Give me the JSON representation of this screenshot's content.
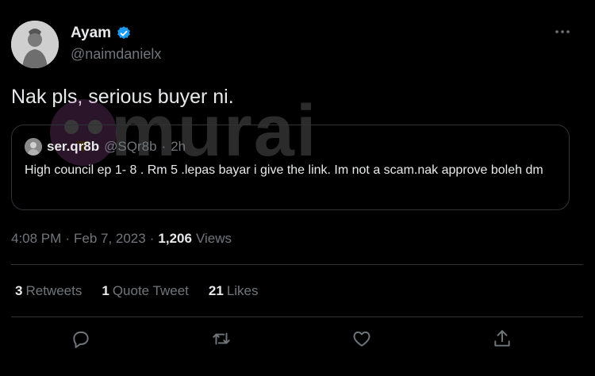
{
  "author": {
    "display_name": "Ayam",
    "handle": "@naimdanielx",
    "verified_icon": "verified-badge-icon"
  },
  "tweet": {
    "text": "Nak pls, serious buyer ni."
  },
  "quote": {
    "name": "ser.qr8b",
    "handle": "@SQr8b",
    "separator": "·",
    "time": "2h",
    "text": "High council ep 1- 8 . Rm 5 .lepas bayar i give the link. Im not a scam.nak approve boleh dm"
  },
  "meta": {
    "time": "4:08 PM",
    "separator1": "·",
    "date": "Feb 7, 2023",
    "separator2": "·",
    "views_count": "1,206",
    "views_label": "Views"
  },
  "stats": {
    "retweets": {
      "count": "3",
      "label": "Retweets"
    },
    "quotes": {
      "count": "1",
      "label": "Quote Tweet"
    },
    "likes": {
      "count": "21",
      "label": "Likes"
    }
  },
  "watermark": {
    "text": "murai"
  },
  "colors": {
    "background": "#000000",
    "text": "#e7e9ea",
    "secondary": "#71767b",
    "border": "#2f3336",
    "verified": "#1d9bf0"
  },
  "icons": {
    "more": "more-horizontal-icon",
    "reply": "reply-icon",
    "retweet": "retweet-icon",
    "like": "heart-icon",
    "share": "share-icon"
  }
}
